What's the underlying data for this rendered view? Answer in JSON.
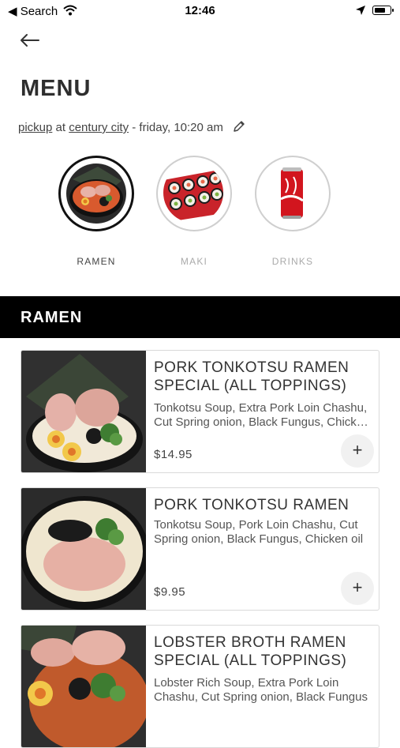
{
  "status_bar": {
    "back_app": "◀ Search",
    "time": "12:46"
  },
  "header": {
    "title": "MENU"
  },
  "order_info": {
    "mode": "pickup",
    "at": "at",
    "location": "century city",
    "when": "- friday, 10:20 am"
  },
  "categories": [
    {
      "label": "RAMEN",
      "active": true
    },
    {
      "label": "MAKI",
      "active": false
    },
    {
      "label": "DRINKS",
      "active": false
    }
  ],
  "section": {
    "title": "RAMEN"
  },
  "items": [
    {
      "name": "PORK TONKOTSU RAMEN SPECIAL (ALL TOPPINGS)",
      "description": "Tonkotsu Soup, Extra Pork Loin Chashu, Cut Spring onion, Black Fungus, Chicken oil",
      "price": "$14.95",
      "add_label": "+"
    },
    {
      "name": "PORK TONKOTSU RAMEN",
      "description": "Tonkotsu Soup, Pork Loin Chashu, Cut Spring onion, Black Fungus, Chicken oil",
      "price": "$9.95",
      "add_label": "+"
    },
    {
      "name": "LOBSTER BROTH RAMEN SPECIAL (ALL TOPPINGS)",
      "description": "Lobster Rich Soup, Extra Pork Loin Chashu, Cut Spring onion, Black Fungus",
      "price": "",
      "add_label": "+"
    }
  ],
  "colors": {
    "banner_bg": "#000000",
    "text": "#333333",
    "muted": "#aaaaaa",
    "add_button_bg": "#f1f1f1"
  }
}
